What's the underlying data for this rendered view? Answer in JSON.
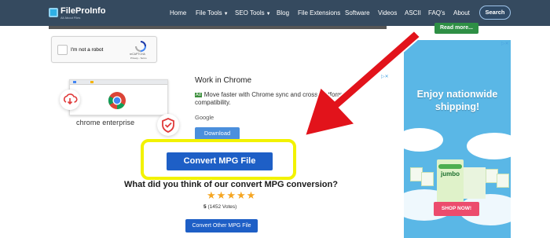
{
  "logo": {
    "name": "FileProInfo",
    "tagline": "All About Files"
  },
  "nav": {
    "items": [
      "Home",
      "File Tools",
      "SEO Tools",
      "Blog",
      "File Extensions",
      "Software",
      "Videos",
      "ASCII",
      "FAQ's",
      "About"
    ],
    "search_label": "Search"
  },
  "read_more": "Read more...",
  "captcha": {
    "label": "I'm not a robot",
    "brand": "reCAPTCHA",
    "terms": "Privacy - Terms"
  },
  "ad": {
    "image_text": "chrome enterprise",
    "title": "Work in Chrome",
    "badge": "Ad",
    "line1": "Move faster with Chrome sync and cross-platform",
    "line2": "compatibility.",
    "source": "Google",
    "download": "Download"
  },
  "convert_button": "Convert MPG File",
  "question": "What did you think of our convert MPG conversion?",
  "rating": {
    "stars": 5,
    "score": "5",
    "votes": "(1452 Votes)"
  },
  "convert_other": "Convert Other MPG File",
  "right_ad": {
    "headline_1": "Enjoy nationwide",
    "headline_2": "shipping!",
    "product": "jumbo",
    "cta": "SHOP NOW!"
  },
  "colors": {
    "nav_bg": "#354a5f",
    "button_blue": "#1e5fc6",
    "highlight": "#f2f200",
    "arrow": "#e2131b"
  }
}
